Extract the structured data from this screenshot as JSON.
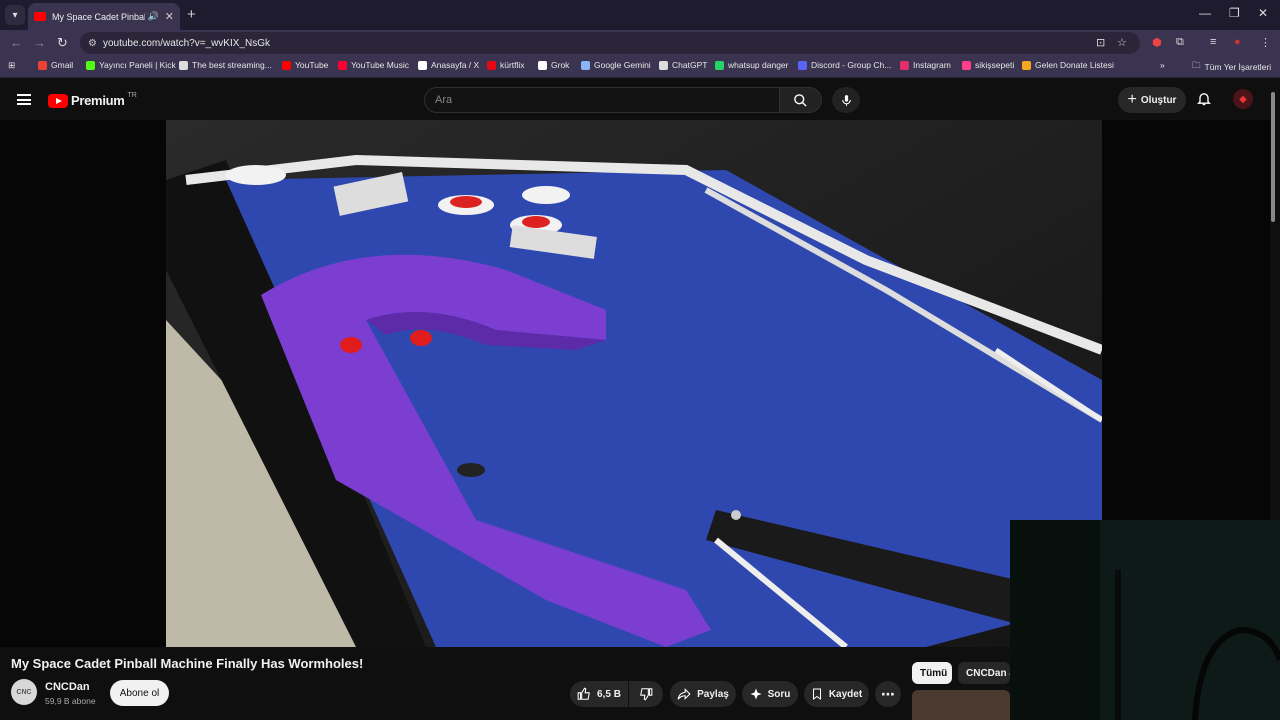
{
  "browser": {
    "tab": {
      "title": "My Space Cadet Pinball Machine Finally Has Wormholes!",
      "short_title": "My Space Cadet Pinball Ma"
    },
    "omnibox": {
      "url": "youtube.com/watch?v=_wvKIX_NsGk"
    },
    "bookmarks": [
      {
        "label": "Gmail",
        "icon": "gmail-icon",
        "color": "#ea4335"
      },
      {
        "label": "Yayıncı Paneli | Kick",
        "icon": "kick-icon",
        "color": "#53fc18"
      },
      {
        "label": "The best streaming...",
        "icon": "streaming-icon",
        "color": "#dddddd"
      },
      {
        "label": "YouTube",
        "icon": "youtube-icon",
        "color": "#ff0000"
      },
      {
        "label": "YouTube Music",
        "icon": "youtube-music-icon",
        "color": "#ff0033"
      },
      {
        "label": "Anasayfa / X",
        "icon": "x-icon",
        "color": "#ffffff"
      },
      {
        "label": "kürtflix",
        "icon": "kurtflix-icon",
        "color": "#e50914"
      },
      {
        "label": "Grok",
        "icon": "grok-icon",
        "color": "#ffffff"
      },
      {
        "label": "Google Gemini",
        "icon": "gemini-icon",
        "color": "#8ab4f8"
      },
      {
        "label": "ChatGPT",
        "icon": "chatgpt-icon",
        "color": "#dddddd"
      },
      {
        "label": "whatsup danger",
        "icon": "whatsapp-icon",
        "color": "#25d366"
      },
      {
        "label": "Discord - Group Ch...",
        "icon": "discord-icon",
        "color": "#5865f2"
      },
      {
        "label": "Instagram",
        "icon": "instagram-icon",
        "color": "#e1306c"
      },
      {
        "label": "sikişsepeti",
        "icon": "sepet-icon",
        "color": "#ff3d8b"
      },
      {
        "label": "Gelen Donate Listesi",
        "icon": "donate-icon",
        "color": "#f5a623"
      }
    ],
    "all_bookmarks": "Tüm Yer İşaretleri"
  },
  "youtube": {
    "logo_text": "Premium",
    "region": "TR",
    "search_placeholder": "Ara",
    "create_label": "Oluştur",
    "video_title": "My Space Cadet Pinball Machine Finally Has Wormholes!",
    "channel": {
      "name": "CNCDan",
      "subscribers": "59,9 B abone",
      "avatar_text": "CNC"
    },
    "subscribe_label": "Abone ol",
    "likes": "6,5 B",
    "share_label": "Paylaş",
    "ask_label": "Soru",
    "save_label": "Kaydet",
    "chips": [
      "Tümü",
      "CNCDan ar"
    ]
  },
  "colors": {
    "accent": "#ff0000",
    "bg": "#0f0f0f",
    "chrome": "#3a3450"
  }
}
